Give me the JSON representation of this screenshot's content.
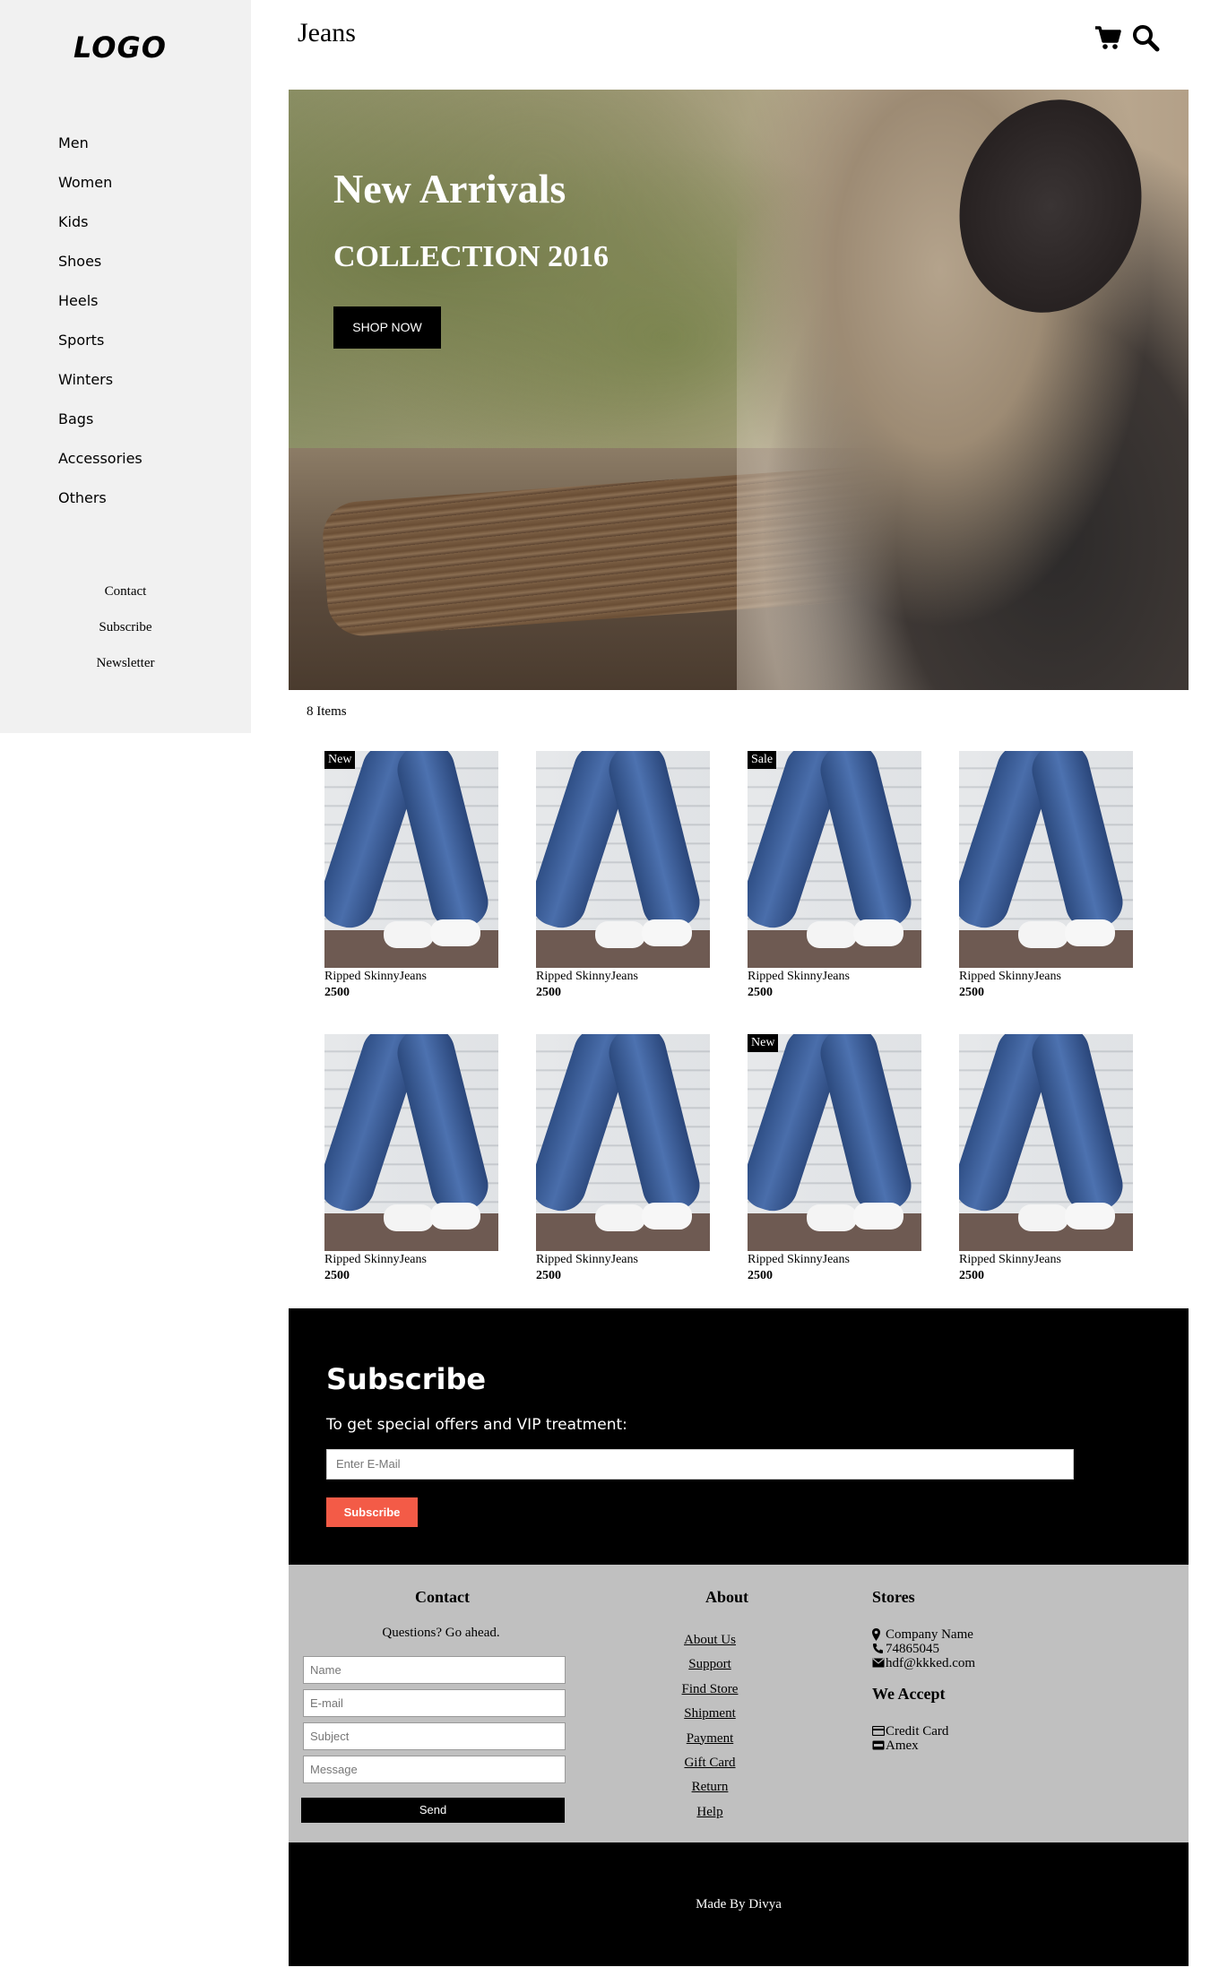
{
  "sidebar": {
    "logo": "LOGO",
    "nav": [
      "Men",
      "Women",
      "Kids",
      "Shoes",
      "Heels",
      "Sports",
      "Winters",
      "Bags",
      "Accessories",
      "Others"
    ],
    "links": [
      "Contact",
      "Subscribe",
      "Newsletter"
    ]
  },
  "header": {
    "title": "Jeans",
    "icons": [
      "cart-icon",
      "search-icon"
    ]
  },
  "hero": {
    "title": "New Arrivals",
    "subtitle": "COLLECTION 2016",
    "button": "SHOP NOW"
  },
  "products": {
    "count_label": "8 Items",
    "items": [
      {
        "name": "Ripped SkinnyJeans",
        "price": "2500",
        "badge": "New"
      },
      {
        "name": "Ripped SkinnyJeans",
        "price": "2500",
        "badge": ""
      },
      {
        "name": "Ripped SkinnyJeans",
        "price": "2500",
        "badge": "Sale"
      },
      {
        "name": "Ripped SkinnyJeans",
        "price": "2500",
        "badge": ""
      },
      {
        "name": "Ripped SkinnyJeans",
        "price": "2500",
        "badge": ""
      },
      {
        "name": "Ripped SkinnyJeans",
        "price": "2500",
        "badge": ""
      },
      {
        "name": "Ripped SkinnyJeans",
        "price": "2500",
        "badge": "New"
      },
      {
        "name": "Ripped SkinnyJeans",
        "price": "2500",
        "badge": ""
      }
    ]
  },
  "subscribe": {
    "title": "Subscribe",
    "text": "To get special offers and VIP treatment:",
    "email_placeholder": "Enter E-Mail",
    "button": "Subscribe"
  },
  "footer": {
    "contact": {
      "heading": "Contact",
      "tagline": "Questions? Go ahead.",
      "name_placeholder": "Name",
      "email_placeholder": "E-mail",
      "subject_placeholder": "Subject",
      "message_placeholder": "Message",
      "send": "Send"
    },
    "about": {
      "heading": "About",
      "links": [
        "About Us",
        "Support",
        "Find Store",
        "Shipment",
        "Payment",
        "Gift Card",
        "Return",
        "Help"
      ]
    },
    "stores": {
      "heading": "Stores",
      "company": "Company Name",
      "phone": "74865045",
      "email": "hdf@kkked.com"
    },
    "accept": {
      "heading": "We Accept",
      "methods": [
        "Credit Card",
        "Amex"
      ]
    },
    "made_by": "Made By Divya"
  },
  "colors": {
    "sidebar_bg": "#f1f1f1",
    "accent_button": "#f35b47",
    "footer_bg": "#c0c0c0",
    "dark": "#000000"
  }
}
